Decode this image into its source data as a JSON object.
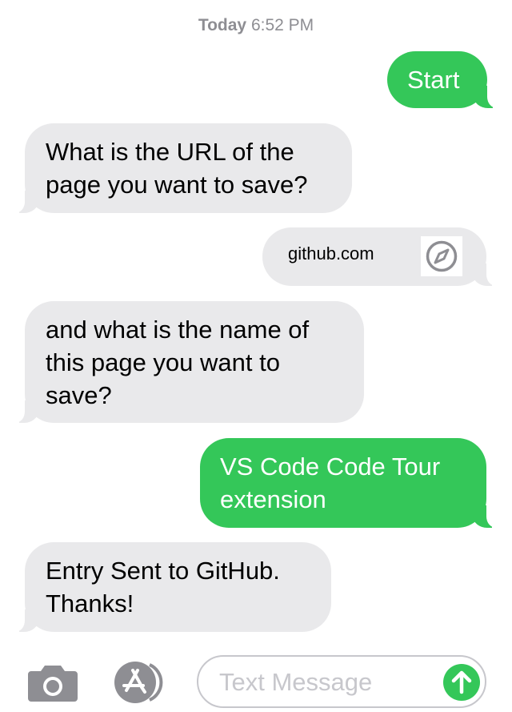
{
  "header": {
    "day": "Today",
    "time": "6:52 PM"
  },
  "messages": [
    {
      "direction": "out",
      "text_lines": [
        "Start"
      ]
    },
    {
      "direction": "in",
      "text_lines": [
        "What is the URL of the",
        "page you want to save?"
      ]
    },
    {
      "direction": "out",
      "type": "link",
      "text_lines": [
        "github.com"
      ],
      "icon": "safari-compass-icon"
    },
    {
      "direction": "in",
      "text_lines": [
        "and what is the name of",
        "this page you want to",
        "save?"
      ]
    },
    {
      "direction": "out",
      "text_lines": [
        "VS Code Code Tour",
        "extension"
      ]
    },
    {
      "direction": "in",
      "text_lines": [
        "Entry Sent to GitHub.",
        "Thanks!"
      ]
    }
  ],
  "composer": {
    "camera_icon": "camera-icon",
    "apps_icon": "app-store-icon",
    "placeholder": "Text Message",
    "send_icon": "send-arrow-icon"
  },
  "colors": {
    "outgoing_bubble": "#34c759",
    "incoming_bubble": "#e9e9eb",
    "timestamp_text": "#8e8e93",
    "placeholder_text": "#c7c7cc"
  }
}
